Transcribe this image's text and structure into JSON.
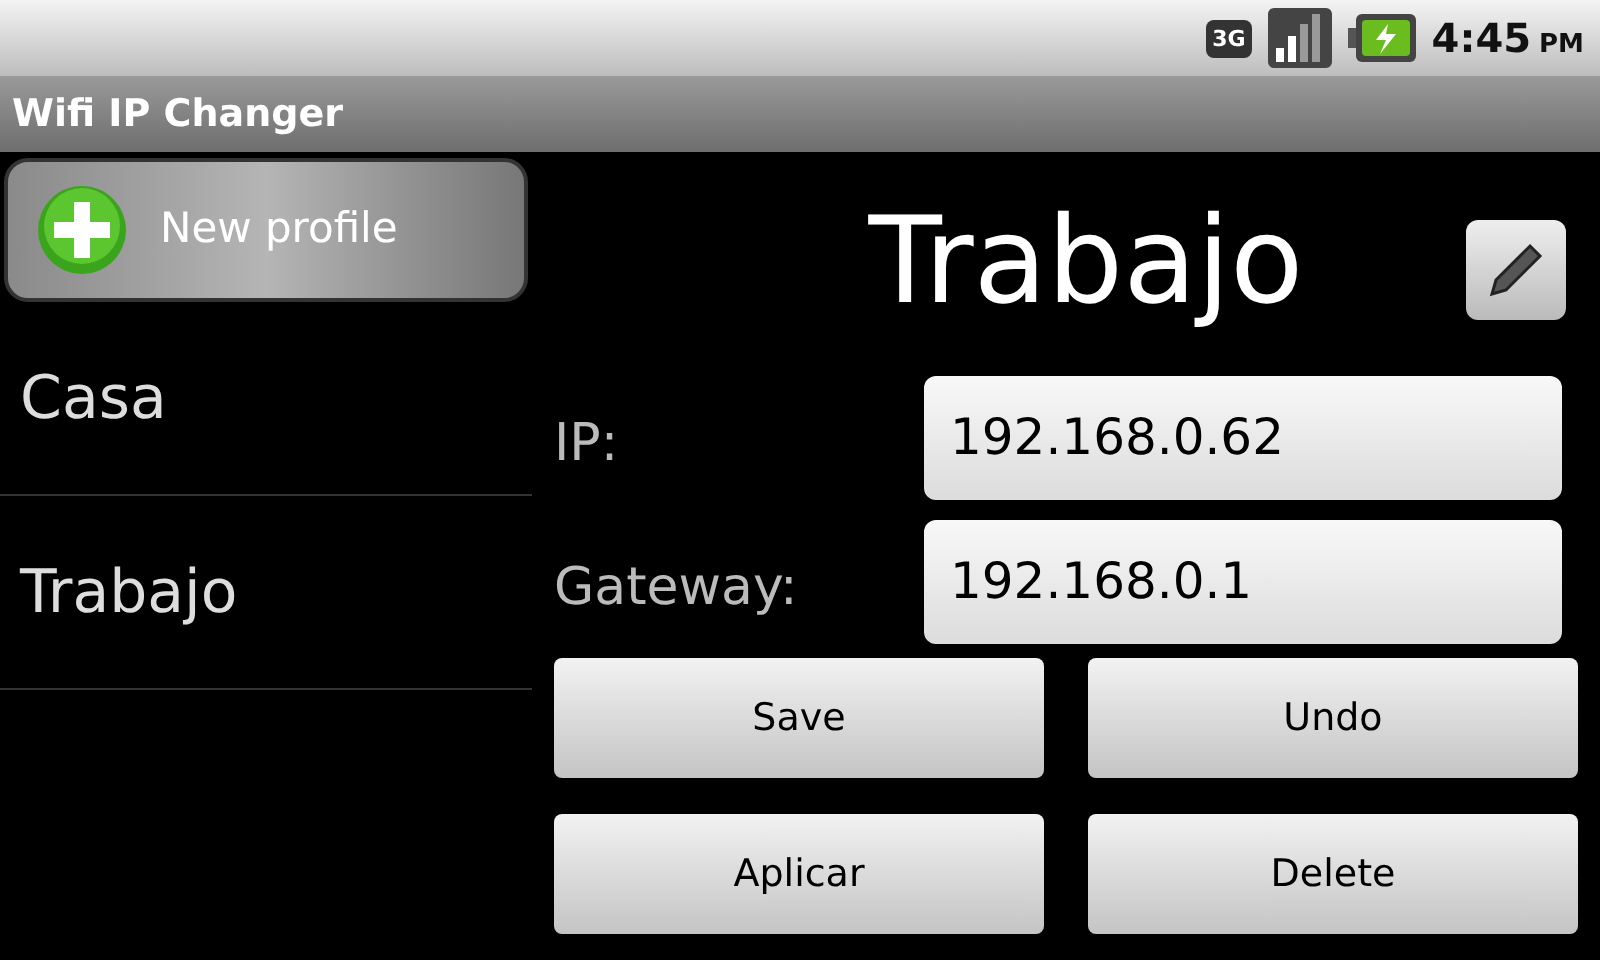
{
  "status_bar": {
    "network": "3G",
    "time": "4:45",
    "ampm": "PM"
  },
  "window": {
    "title": "Wifi IP Changer"
  },
  "sidebar": {
    "new_profile": "New profile",
    "items": [
      {
        "label": "Casa"
      },
      {
        "label": "Trabajo"
      }
    ]
  },
  "profile": {
    "title": "Trabajo",
    "fields": [
      {
        "label": "IP:",
        "value": "192.168.0.62"
      },
      {
        "label": "Gateway:",
        "value": "192.168.0.1"
      }
    ]
  },
  "buttons": [
    "Save",
    "Undo",
    "Aplicar",
    "Delete"
  ]
}
